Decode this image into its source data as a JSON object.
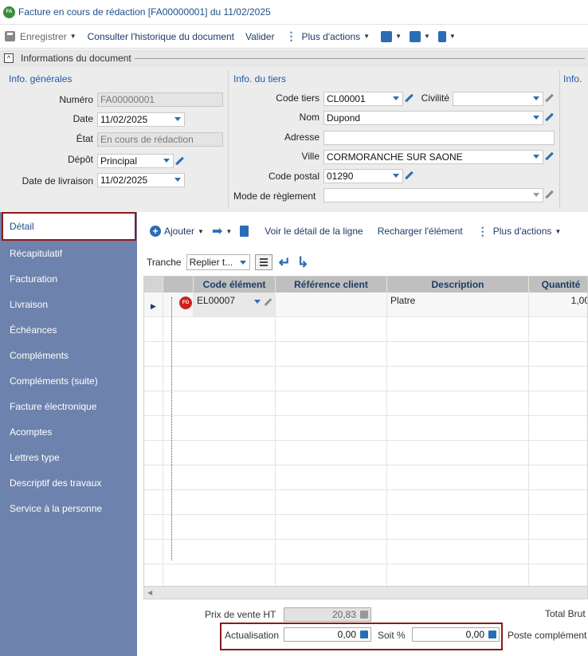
{
  "window": {
    "badge": "FA",
    "title": "Facture en cours de rédaction [FA00000001] du 11/02/2025"
  },
  "toolbar": {
    "save": "Enregistrer",
    "history": "Consulter l'historique du document",
    "validate": "Valider",
    "more": "Plus d'actions"
  },
  "section": {
    "title": "Informations du document",
    "collapse": "^"
  },
  "general": {
    "title": "Info. générales",
    "numero_label": "Numéro",
    "numero": "FA00000001",
    "date_label": "Date",
    "date": "11/02/2025",
    "etat_label": "État",
    "etat": "En cours de rédaction",
    "depot_label": "Dépôt",
    "depot": "Principal",
    "livraison_label": "Date de livraison",
    "livraison": "11/02/2025"
  },
  "tiers": {
    "title": "Info. du tiers",
    "code_label": "Code tiers",
    "code": "CL00001",
    "civilite_label": "Civilité",
    "civilite": "",
    "nom_label": "Nom",
    "nom": "Dupond",
    "adresse_label": "Adresse",
    "adresse": "",
    "ville_label": "Ville",
    "ville": "CORMORANCHE SUR SAONE",
    "cp_label": "Code postal",
    "cp": "01290",
    "reglement_label": "Mode de règlement",
    "reglement": ""
  },
  "info_third": {
    "title": "Info."
  },
  "sidebar": {
    "items": [
      "Détail",
      "Récapitulatif",
      "Facturation",
      "Livraison",
      "Échéances",
      "Compléments",
      "Compléments (suite)",
      "Facture électronique",
      "Acomptes",
      "Lettres type",
      "Descriptif des travaux",
      "Service à la personne"
    ]
  },
  "detail_toolbar": {
    "add": "Ajouter",
    "view_line": "Voir le détail de la ligne",
    "reload": "Recharger l'élément",
    "more": "Plus d'actions"
  },
  "tranche": {
    "label": "Tranche",
    "value": "Replier t..."
  },
  "grid": {
    "columns": [
      "Code élément",
      "Référence client",
      "Description",
      "Quantité"
    ],
    "rows": [
      {
        "badge": "FO",
        "code": "EL00007",
        "ref": "",
        "description": "Platre",
        "qty": "1,00"
      }
    ]
  },
  "totals": {
    "prix_label": "Prix de vente HT",
    "prix": "20,83",
    "actualisation_label": "Actualisation",
    "actualisation": "0,00",
    "soit_label": "Soit %",
    "soit": "0,00",
    "total_brut_label": "Total Brut",
    "poste_label": "Poste complément"
  }
}
